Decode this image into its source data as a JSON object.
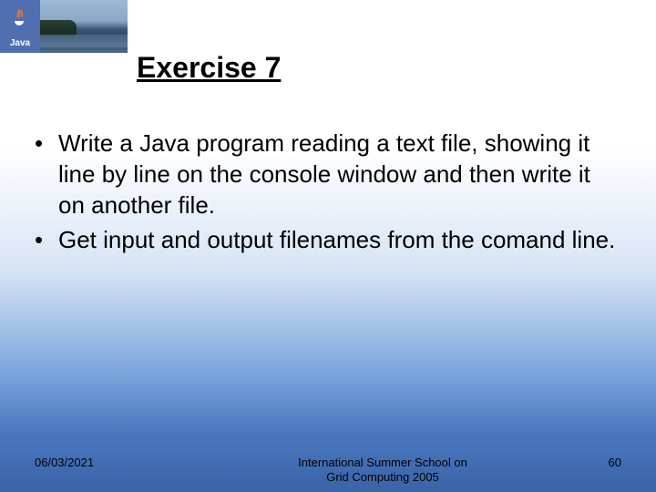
{
  "logo": {
    "text": "Java"
  },
  "title": "Exercise 7",
  "bullets": [
    "Write a Java program reading a text file, showing it line by line on the console window and then write it on another file.",
    "Get input and output filenames from the comand line."
  ],
  "footer": {
    "date": "06/03/2021",
    "center_line1": "International Summer School on",
    "center_line2": "Grid Computing 2005",
    "page": "60"
  }
}
